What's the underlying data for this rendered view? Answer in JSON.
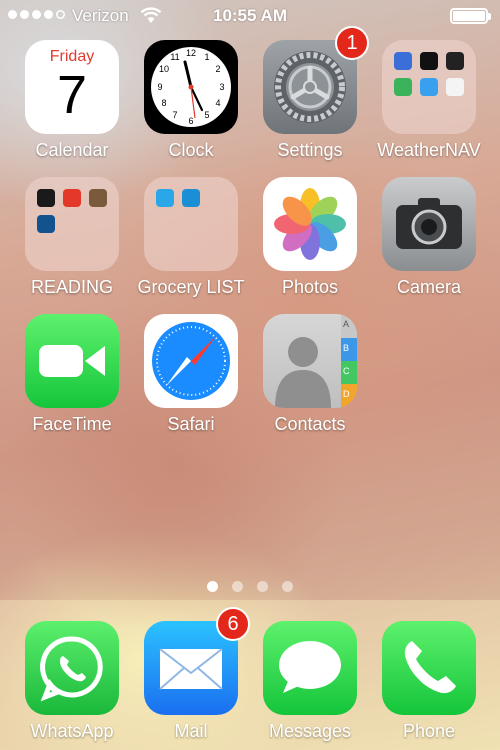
{
  "status_bar": {
    "carrier": "Verizon",
    "time": "10:55 AM",
    "signal_bars_filled": 4,
    "signal_bars_total": 5,
    "battery_level": 1.0
  },
  "apps": {
    "calendar": {
      "label": "Calendar",
      "weekday": "Friday",
      "day": "7"
    },
    "clock": {
      "label": "Clock"
    },
    "settings": {
      "label": "Settings",
      "badge": "1"
    },
    "weathernav": {
      "label": "WeatherNAV"
    },
    "reading": {
      "label": "READING"
    },
    "grocery": {
      "label": "Grocery LIST"
    },
    "photos": {
      "label": "Photos"
    },
    "camera": {
      "label": "Camera"
    },
    "facetime": {
      "label": "FaceTime"
    },
    "safari": {
      "label": "Safari"
    },
    "contacts": {
      "label": "Contacts",
      "tabs": [
        "A",
        "B",
        "C",
        "D"
      ]
    }
  },
  "page_indicator": {
    "pages": 4,
    "current": 1
  },
  "dock": {
    "whatsapp": {
      "label": "WhatsApp"
    },
    "mail": {
      "label": "Mail",
      "badge": "6"
    },
    "messages": {
      "label": "Messages"
    },
    "phone": {
      "label": "Phone"
    }
  },
  "colors": {
    "badge": "#e3271b",
    "calendar_red": "#e33b2e",
    "ios_green": "#4cd964",
    "ios_blue": "#1a8cff"
  }
}
